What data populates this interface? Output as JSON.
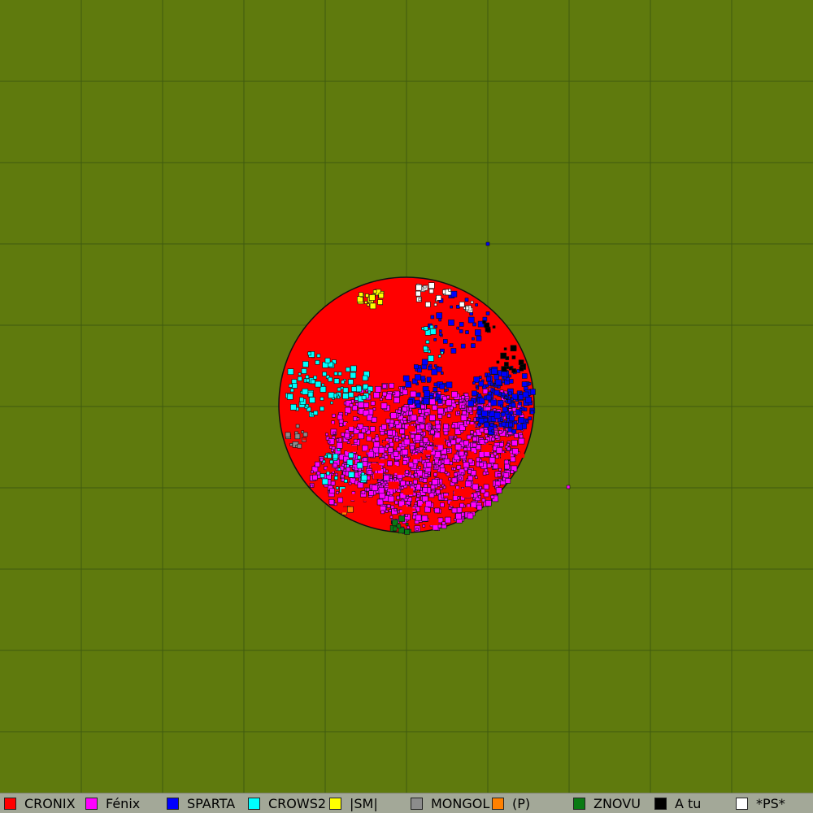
{
  "map": {
    "background_color": "#5f7a0d",
    "grid_color": "#3f5a10",
    "planet_edge_color": "#111111",
    "planet_base_color": "#ff0000",
    "stray_markers": [
      {
        "alliance": "SPARTA",
        "color": "#0000ff"
      },
      {
        "alliance": "Fénix",
        "color": "#ff00ff"
      }
    ]
  },
  "legend": {
    "items": [
      {
        "label": "CRONIX",
        "color": "#ff0000"
      },
      {
        "label": "Fénix",
        "color": "#ff00ff"
      },
      {
        "label": "SPARTA",
        "color": "#0000ff"
      },
      {
        "label": "CROWS2",
        "color": "#00ffff"
      },
      {
        "label": "|SM|",
        "color": "#ffff00"
      },
      {
        "label": "MONGOL",
        "color": "#8c8c8c"
      },
      {
        "label": "(P)",
        "color": "#ff8000"
      },
      {
        "label": "ZNOVU",
        "color": "#0a7a14"
      },
      {
        "label": "A tu",
        "color": "#000000"
      },
      {
        "label": "*PS*",
        "color": "#ffffff"
      }
    ]
  }
}
